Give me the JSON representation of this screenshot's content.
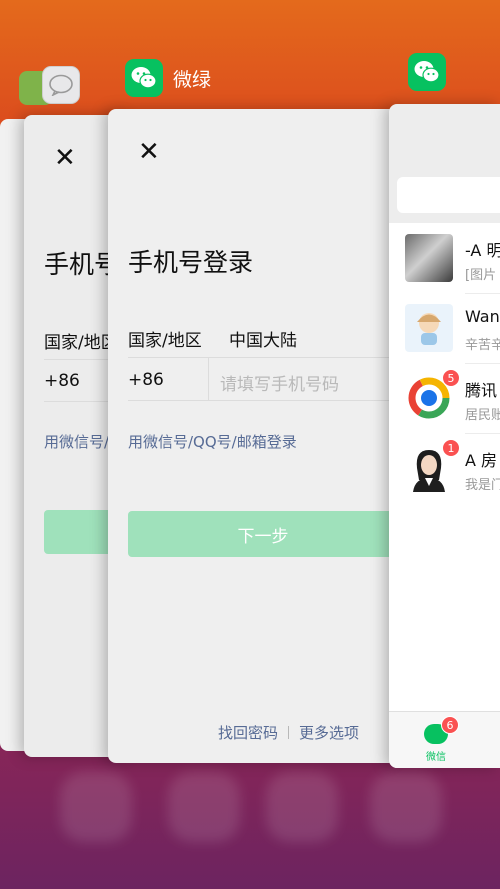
{
  "switcher": {
    "front_app": {
      "name": "微绿",
      "icon": "wechat-icon"
    }
  },
  "login_back": {
    "title": "手机号登录",
    "country_label": "国家/地区",
    "code": "+86",
    "alt_login": "用微信号/QQ号/邮箱登录"
  },
  "login": {
    "title": "手机号登录",
    "country_label": "国家/地区",
    "country_value": "中国大陆",
    "code": "+86",
    "phone_placeholder": "请填写手机号码",
    "alt_login": "用微信号/QQ号/邮箱登录",
    "next_button": "下一步",
    "forgot_password": "找回密码",
    "more_options": "更多选项"
  },
  "wechat": {
    "chats": [
      {
        "name": "-A 明",
        "preview": "[图片",
        "badge": ""
      },
      {
        "name": "Wan",
        "preview": "辛苦辛",
        "badge": ""
      },
      {
        "name": "腾讯",
        "preview": "居民账",
        "badge": "5"
      },
      {
        "name": "A 房",
        "preview": "我是门",
        "badge": "1"
      }
    ],
    "tab_label": "微信",
    "tab_badge": "6"
  },
  "colors": {
    "wechat_green": "#07c160",
    "button_disabled": "#9fe1bb",
    "link_blue": "#576b95",
    "badge_red": "#fa5151"
  }
}
